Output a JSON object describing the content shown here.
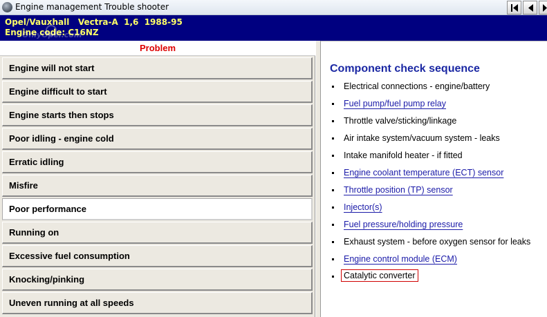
{
  "window": {
    "title": "Engine management Trouble shooter"
  },
  "vehicle": {
    "model_line": "Opel/Vauxhall   Vectra-A  1,6  1988-95",
    "engine_line": "Engine code: C16NZ",
    "watermark": "OnlyOpel.com"
  },
  "problems": {
    "heading": "Problem",
    "items": [
      {
        "label": "Engine will not start",
        "selected": false
      },
      {
        "label": "Engine difficult to start",
        "selected": false
      },
      {
        "label": "Engine starts then stops",
        "selected": false
      },
      {
        "label": "Poor idling - engine cold",
        "selected": false
      },
      {
        "label": "Erratic idling",
        "selected": false
      },
      {
        "label": "Misfire",
        "selected": false
      },
      {
        "label": "Poor performance",
        "selected": true
      },
      {
        "label": "Running on",
        "selected": false
      },
      {
        "label": "Excessive fuel consumption",
        "selected": false
      },
      {
        "label": "Knocking/pinking",
        "selected": false
      },
      {
        "label": "Uneven running at all speeds",
        "selected": false
      }
    ]
  },
  "checks": {
    "title": "Component check sequence",
    "items": [
      {
        "label": "Electrical connections - engine/battery",
        "link": false
      },
      {
        "label": "Fuel pump/fuel pump relay",
        "link": true
      },
      {
        "label": "Throttle valve/sticking/linkage",
        "link": false
      },
      {
        "label": "Air intake system/vacuum system - leaks",
        "link": false
      },
      {
        "label": "Intake manifold heater - if fitted",
        "link": false
      },
      {
        "label": "Engine coolant temperature (ECT) sensor",
        "link": true
      },
      {
        "label": "Throttle position (TP) sensor",
        "link": true
      },
      {
        "label": "Injector(s)",
        "link": true
      },
      {
        "label": "Fuel pressure/holding pressure",
        "link": true
      },
      {
        "label": "Exhaust system - before oxygen sensor for leaks",
        "link": false
      },
      {
        "label": "Engine control module (ECM)",
        "link": true
      },
      {
        "label": "Catalytic converter",
        "link": false,
        "highlighted": true
      }
    ]
  },
  "colors": {
    "header_bg": "#000080",
    "header_text": "#ffff66",
    "problem_heading": "#dd0000",
    "section_title": "#1a27a3",
    "link": "#1a1aa8",
    "highlight_box": "#d00000"
  },
  "icons": {
    "app": "app-gear-icon",
    "nav_first": "first-page-icon",
    "nav_prev": "previous-page-icon",
    "nav_next": "next-page-icon"
  }
}
